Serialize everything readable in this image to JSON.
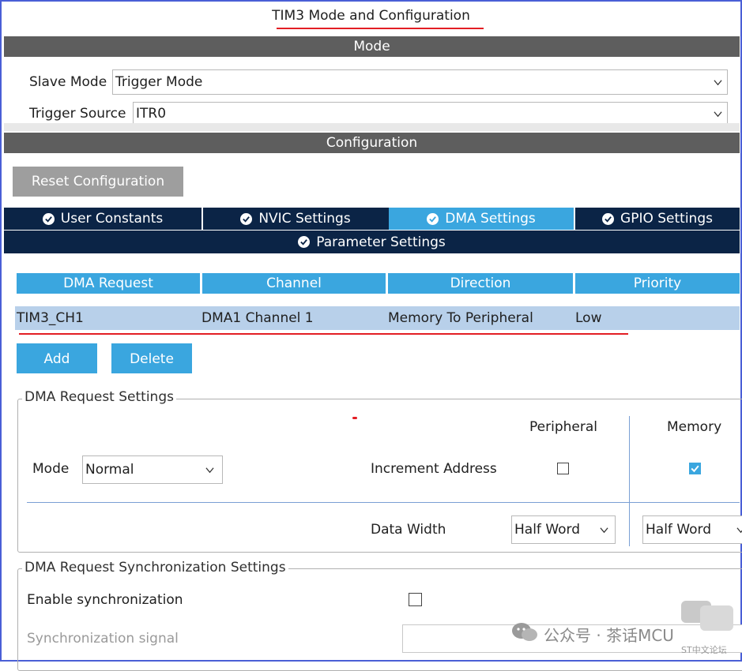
{
  "title": "TIM3 Mode and Configuration",
  "mode_section": {
    "header": "Mode",
    "slave_mode_label": "Slave Mode",
    "slave_mode_value": "Trigger Mode",
    "trigger_source_label": "Trigger Source",
    "trigger_source_value": "ITR0"
  },
  "config_section": {
    "header": "Configuration",
    "reset_button": "Reset Configuration"
  },
  "tabs": [
    {
      "label": "User Constants",
      "active": false
    },
    {
      "label": "NVIC Settings",
      "active": false
    },
    {
      "label": "DMA Settings",
      "active": true
    },
    {
      "label": "GPIO Settings",
      "active": false
    },
    {
      "label": "Parameter Settings",
      "active": false
    }
  ],
  "dma_table": {
    "columns": [
      "DMA Request",
      "Channel",
      "Direction",
      "Priority"
    ],
    "rows": [
      [
        "TIM3_CH1",
        "DMA1 Channel 1",
        "Memory To Peripheral",
        "Low"
      ]
    ]
  },
  "buttons": {
    "add": "Add",
    "delete": "Delete"
  },
  "dma_request_settings": {
    "legend": "DMA Request Settings",
    "peripheral_header": "Peripheral",
    "memory_header": "Memory",
    "mode_label": "Mode",
    "mode_value": "Normal",
    "increment_address_label": "Increment Address",
    "peripheral_increment": false,
    "memory_increment": true,
    "data_width_label": "Data Width",
    "peripheral_data_width": "Half Word",
    "memory_data_width": "Half Word"
  },
  "sync_settings": {
    "legend": "DMA Request Synchronization Settings",
    "enable_label": "Enable synchronization",
    "enable_checked": false,
    "signal_label": "Synchronization signal",
    "signal_value": ""
  },
  "watermark": {
    "text": "公众号 · 茶话MCU",
    "corner_text": "ST中文论坛"
  },
  "colors": {
    "accent": "#3aa6df",
    "tab_dark": "#0b2446",
    "section_bar": "#5e5e5e",
    "annotation_red": "#e31e24",
    "row_selected": "#b8d0ea"
  }
}
